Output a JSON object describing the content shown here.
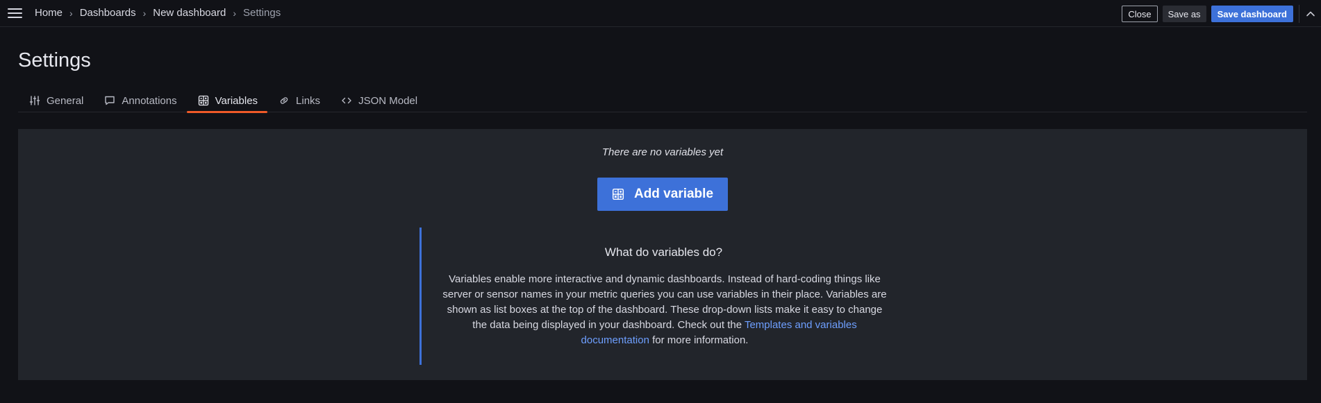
{
  "header": {
    "breadcrumbs": [
      {
        "label": "Home"
      },
      {
        "label": "Dashboards"
      },
      {
        "label": "New dashboard"
      },
      {
        "label": "Settings"
      }
    ],
    "separator": "›",
    "close_label": "Close",
    "save_as_label": "Save as",
    "save_dashboard_label": "Save dashboard",
    "menu_icon": "hamburger-menu-icon",
    "collapse_icon": "chevron-up-icon"
  },
  "page": {
    "title": "Settings"
  },
  "tabs": [
    {
      "label": "General",
      "icon": "sliders-icon",
      "active": false
    },
    {
      "label": "Annotations",
      "icon": "comment-icon",
      "active": false
    },
    {
      "label": "Variables",
      "icon": "calculator-icon",
      "active": true
    },
    {
      "label": "Links",
      "icon": "link-icon",
      "active": false
    },
    {
      "label": "JSON Model",
      "icon": "code-brackets-icon",
      "active": false
    }
  ],
  "empty_state": {
    "message": "There are no variables yet",
    "add_button_label": "Add variable",
    "add_button_icon": "calculator-icon"
  },
  "info": {
    "title": "What do variables do?",
    "body_before": "Variables enable more interactive and dynamic dashboards. Instead of hard-coding things like server or sensor names in your metric queries you can use variables in their place. Variables are shown as list boxes at the top of the dashboard. These drop-down lists make it easy to change the data being displayed in your dashboard. Check out the ",
    "link_text": "Templates and variables documentation",
    "body_after": " for more information."
  },
  "colors": {
    "background": "#111217",
    "panel": "#22252b",
    "primary": "#3d71d9",
    "active_tab_underline": "#f05a28",
    "link": "#6e9fff"
  }
}
